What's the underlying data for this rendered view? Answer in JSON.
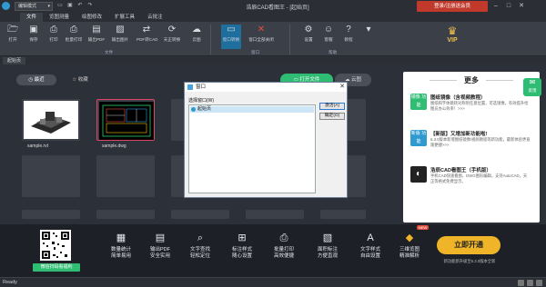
{
  "titlebar": {
    "mode": "编辑模式",
    "title": "浩辰CAD看图王 - [起始页]",
    "login_label": "登录/注册送会员"
  },
  "menu_tabs": [
    "文件",
    "览图测量",
    "绘图修改",
    "扩展工具",
    "云批注"
  ],
  "ribbon": {
    "buttons": [
      {
        "label": "打开",
        "icon": "folder-open"
      },
      {
        "label": "保存",
        "icon": "save"
      },
      {
        "label": "打印",
        "icon": "print"
      },
      {
        "label": "批量打印",
        "icon": "batch-print"
      },
      {
        "label": "输出PDF",
        "icon": "pdf"
      },
      {
        "label": "输出图片",
        "icon": "image"
      },
      {
        "label": "PDF转CAD",
        "icon": "pdf-to-cad"
      },
      {
        "label": "天正转换",
        "icon": "convert"
      },
      {
        "label": "云图",
        "icon": "cloud"
      },
      {
        "label": "窗口转换",
        "icon": "window-switch"
      },
      {
        "label": "窗口全部关闭",
        "icon": "close-all"
      },
      {
        "label": "设置",
        "icon": "gear"
      },
      {
        "label": "客服",
        "icon": "support"
      },
      {
        "label": "教程",
        "icon": "help"
      },
      {
        "label": "",
        "icon": "expand"
      }
    ],
    "groups": [
      "文件",
      "窗口",
      "帮助"
    ]
  },
  "vip_label": "VIP",
  "doc_tab": "起始页",
  "start_page": {
    "recent_label": "最近",
    "favorite_label": "收藏",
    "open_file_label": "打开文件",
    "cloud_label": "云图",
    "files": [
      {
        "name": "sample.rvt"
      },
      {
        "name": "sample.dwg"
      }
    ]
  },
  "more_panel": {
    "title": "更多",
    "promos": [
      {
        "icon_text": "镜像 功能",
        "title": "图纸镜像（含视频教程）",
        "desc": "图纸和字体跳转对称到任意位置，可选镜像，有效提升绘图员办公效率！>>>"
      },
      {
        "icon_text": "新版 功能",
        "title": "【新版】又增加新功能啦!",
        "desc": "6.3.0版本新增图纸镜像/视频教程等新功能，最新体验更直观便捷>>>"
      },
      {
        "icon_text": "",
        "title": "浩辰CAD看图王（手机版）",
        "desc": "手机CAD快速看图、DWG图形编辑，支持AutoCAD，天正等格式免费显示。"
      }
    ]
  },
  "feedback_label": "反馈",
  "dialog": {
    "title": "窗口",
    "label": "选择窗口(W)",
    "items": [
      "起始页"
    ],
    "activate_label": "激活(A)",
    "ok_label": "确定(O)"
  },
  "bottom": {
    "qr_caption": "微信扫码看福利",
    "features": [
      {
        "l1": "数量统计",
        "l2": "简单易用",
        "icon": "count"
      },
      {
        "l1": "输出PDF",
        "l2": "安全实用",
        "icon": "pdf"
      },
      {
        "l1": "文字查找",
        "l2": "轻松定位",
        "icon": "text-search"
      },
      {
        "l1": "标注样式",
        "l2": "随心设置",
        "icon": "dimension"
      },
      {
        "l1": "批量打印",
        "l2": "高效便捷",
        "icon": "batch-print"
      },
      {
        "l1": "面积标注",
        "l2": "方便直观",
        "icon": "area"
      },
      {
        "l1": "文字样式",
        "l2": "自由设置",
        "icon": "text-style"
      },
      {
        "l1": "三维览图",
        "l2": "精准解析",
        "icon": "3d"
      }
    ],
    "new_badge": "NEW",
    "open_now_label": "立即开通",
    "open_now_sub": "新功能新升级至6.3.0版本全新"
  },
  "status": {
    "text": "Ready"
  },
  "colors": {
    "accent_green": "#2ebd73",
    "accent_blue": "#1f6f9e",
    "login_red": "#c0392b",
    "vip_gold": "#f0c24b",
    "open_orange": "#f0b429"
  }
}
